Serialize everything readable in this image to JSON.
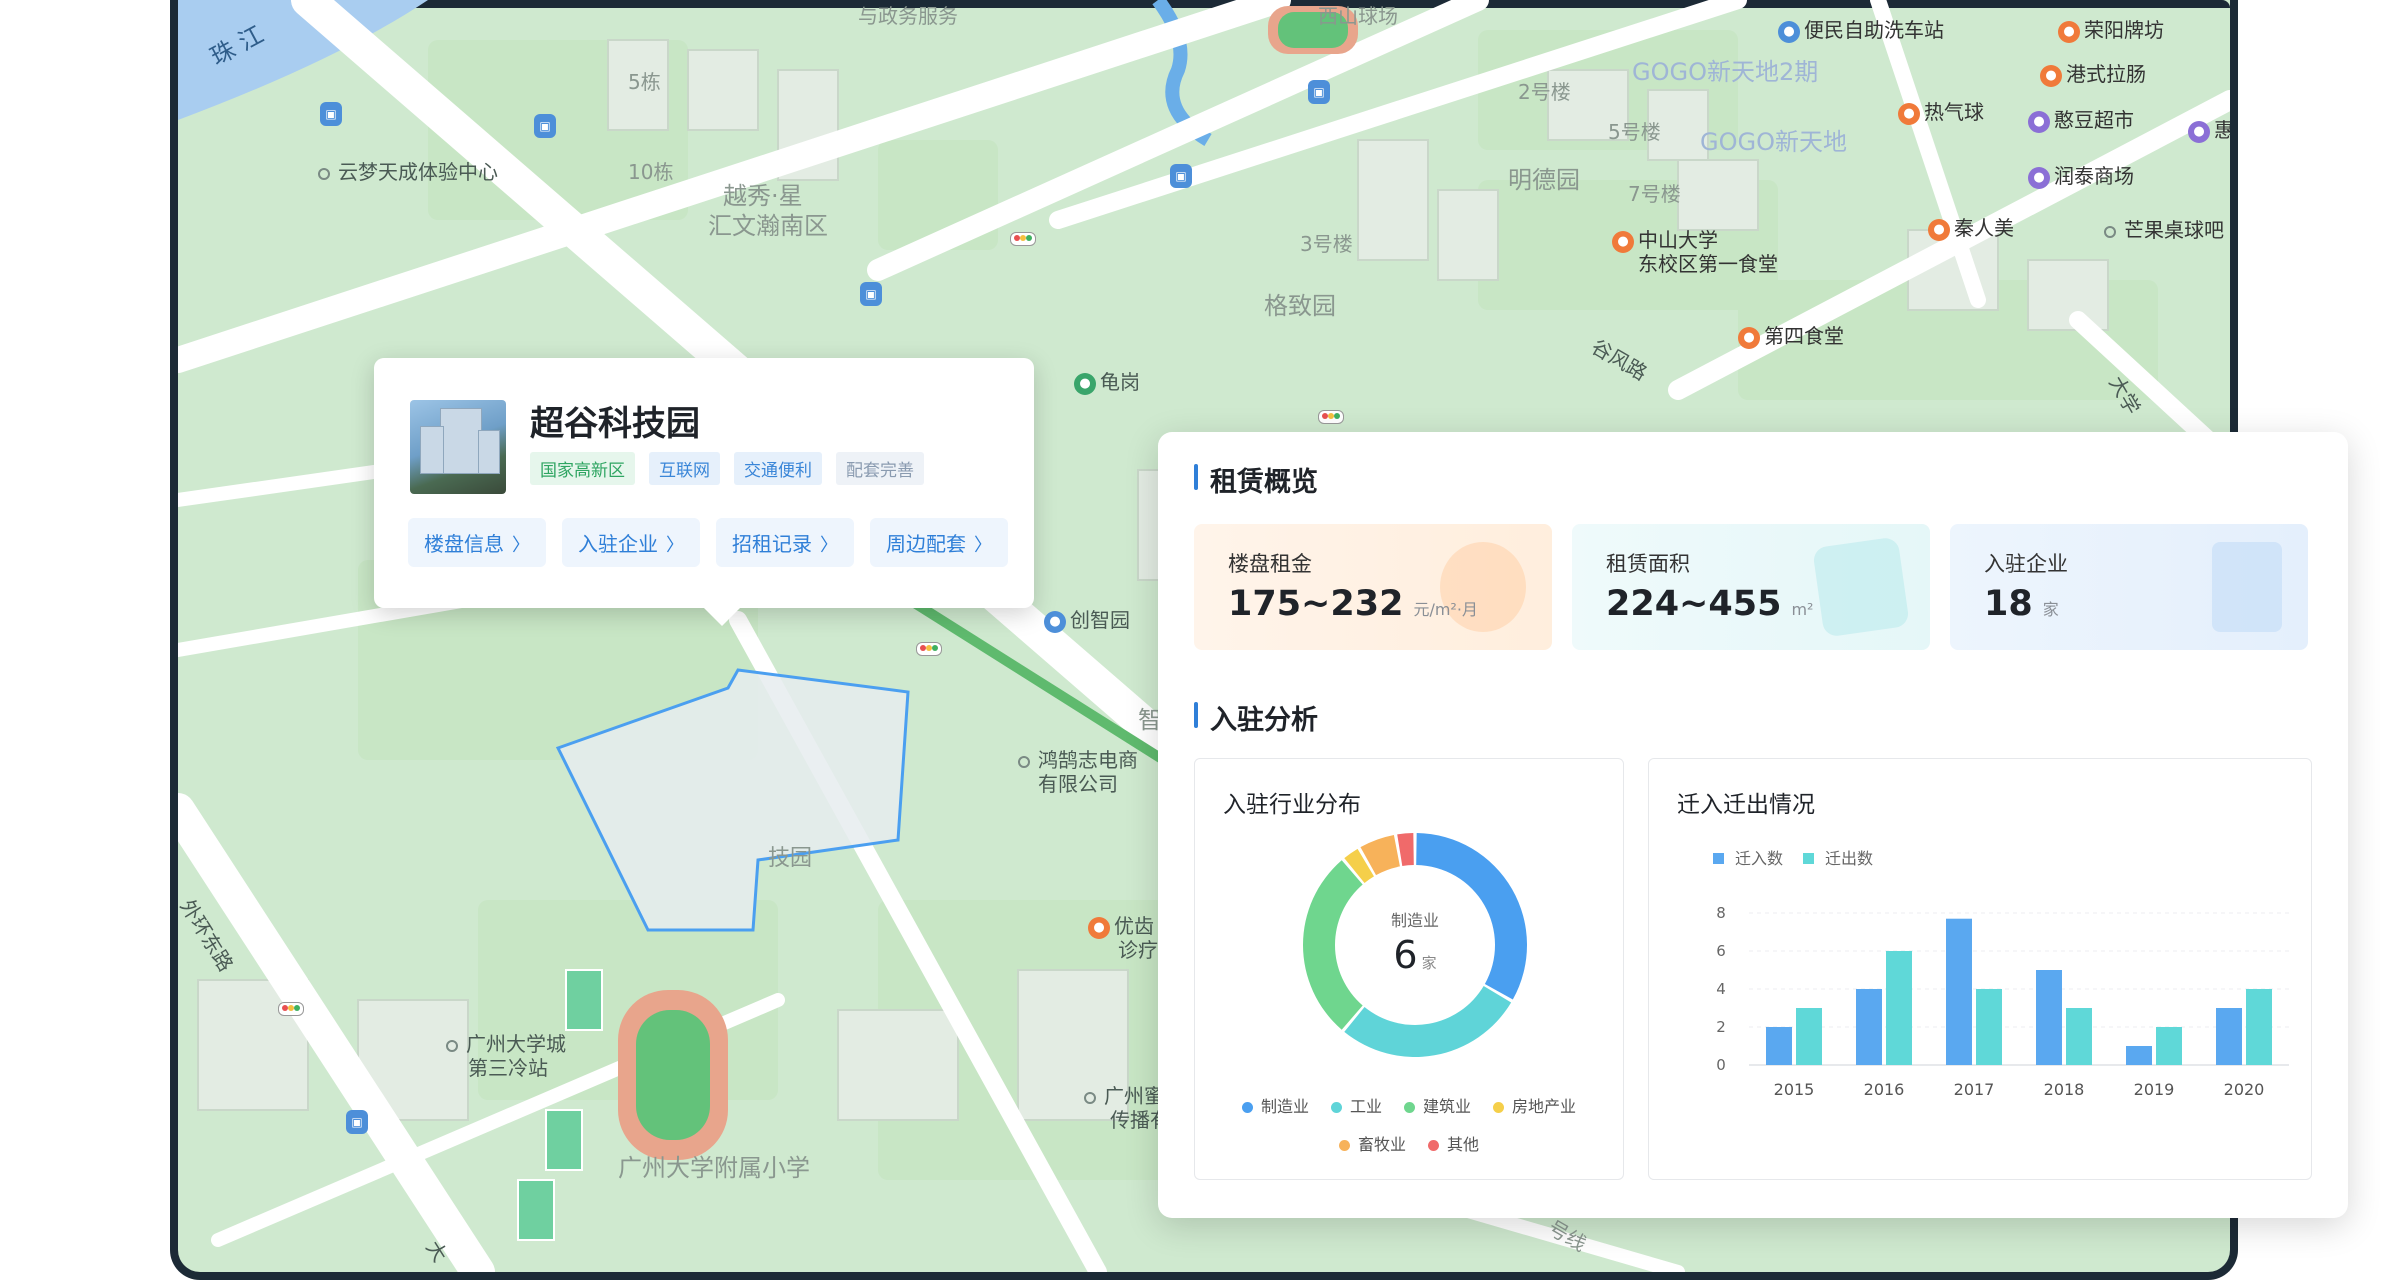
{
  "map": {
    "labels": [
      {
        "text": "珠 江",
        "grey": false
      },
      {
        "text": "5栋",
        "grey": true
      },
      {
        "text": "10栋",
        "grey": true
      },
      {
        "text": "越秀·星",
        "grey": true
      },
      {
        "text": "汇文瀚南区",
        "grey": true
      },
      {
        "text": "云梦天成体验中心",
        "grey": false
      },
      {
        "text": "2号楼",
        "grey": true
      },
      {
        "text": "5号楼",
        "grey": true
      },
      {
        "text": "7号楼",
        "grey": true
      },
      {
        "text": "3号楼",
        "grey": true
      },
      {
        "text": "明德园",
        "grey": true
      },
      {
        "text": "格致园",
        "grey": true
      },
      {
        "text": "GOGO新天地2期",
        "grey": true
      },
      {
        "text": "GOGO新天地",
        "grey": true
      },
      {
        "text": "龟岗",
        "grey": false
      },
      {
        "text": "谷风路",
        "grey": false
      },
      {
        "text": "创智园",
        "grey": false
      },
      {
        "text": "鸿鹄志电商",
        "grey": false
      },
      {
        "text": "有限公司",
        "grey": false
      },
      {
        "text": "技园",
        "grey": true
      },
      {
        "text": "优齿",
        "grey": false
      },
      {
        "text": "诊疗",
        "grey": false
      },
      {
        "text": "广州大学城",
        "grey": false
      },
      {
        "text": "第三冷站",
        "grey": false
      },
      {
        "text": "广州大学附属小学",
        "grey": true
      },
      {
        "text": "广州蜜",
        "grey": false
      },
      {
        "text": "传播有",
        "grey": false
      },
      {
        "text": "大学",
        "grey": false
      },
      {
        "text": "外环东路",
        "grey": false
      },
      {
        "text": "大",
        "grey": false
      },
      {
        "text": "智",
        "grey": true
      },
      {
        "text": "号线",
        "grey": true
      },
      {
        "text": "西山球场",
        "grey": true
      },
      {
        "text": "与政务服务",
        "grey": true
      }
    ],
    "pois": [
      {
        "text": "便民自助洗车站",
        "icon": "car-wash-icon",
        "color": "#4d8fd9"
      },
      {
        "text": "荣阳牌坊",
        "icon": "landmark-icon",
        "color": "#f07a3a"
      },
      {
        "text": "港式拉肠",
        "icon": "restaurant-icon",
        "color": "#f07a3a"
      },
      {
        "text": "热气球",
        "icon": "restaurant-icon",
        "color": "#f07a3a"
      },
      {
        "text": "憨豆超市",
        "icon": "shop-icon",
        "color": "#8b6fd6"
      },
      {
        "text": "惠",
        "icon": "shop-icon",
        "color": "#8b6fd6"
      },
      {
        "text": "润泰商场",
        "icon": "shop-icon",
        "color": "#8b6fd6"
      },
      {
        "text": "秦人美",
        "icon": "restaurant-icon",
        "color": "#f07a3a"
      },
      {
        "text": "芒果桌球吧",
        "icon": "dot-icon",
        "color": "#7a8a84"
      },
      {
        "text": "中山大学",
        "icon": "restaurant-icon",
        "color": "#f07a3a"
      },
      {
        "text": "东校区第一食堂",
        "icon": "none",
        "color": "#f07a3a"
      },
      {
        "text": "第四食堂",
        "icon": "restaurant-icon",
        "color": "#f07a3a"
      }
    ]
  },
  "park_card": {
    "title": "超谷科技园",
    "tags": [
      "国家高新区",
      "互联网",
      "交通便利",
      "配套完善"
    ],
    "buttons": [
      "楼盘信息",
      "入驻企业",
      "招租记录",
      "周边配套"
    ]
  },
  "panel": {
    "rent_title": "租赁概览",
    "stats": [
      {
        "label": "楼盘租金",
        "value": "175~232",
        "unit": "元/m²·月"
      },
      {
        "label": "租赁面积",
        "value": "224~455",
        "unit": "m²"
      },
      {
        "label": "入驻企业",
        "value": "18",
        "unit": "家"
      }
    ],
    "analysis_title": "入驻分析",
    "industry_title": "入驻行业分布",
    "migration_title": "迁入迁出情况"
  },
  "chart_data": [
    {
      "type": "pie",
      "title": "入驻行业分布",
      "center_label": "制造业",
      "center_value": "6",
      "center_unit": "家",
      "slices": [
        {
          "name": "制造业",
          "value": 6,
          "color": "#4a9ff0"
        },
        {
          "name": "工业",
          "value": 5,
          "color": "#5fd4d8"
        },
        {
          "name": "建筑业",
          "value": 5,
          "color": "#6fd68e"
        },
        {
          "name": "房地产业",
          "value": 0.5,
          "color": "#f5cf4a"
        },
        {
          "name": "畜牧业",
          "value": 1,
          "color": "#f7b25a"
        },
        {
          "name": "其他",
          "value": 0.5,
          "color": "#f06a6a"
        }
      ]
    },
    {
      "type": "bar",
      "title": "迁入迁出情况",
      "categories": [
        "2015",
        "2016",
        "2017",
        "2018",
        "2019",
        "2020"
      ],
      "series": [
        {
          "name": "迁入数",
          "values": [
            2,
            4,
            7.7,
            5,
            1,
            3
          ],
          "color": "#5aa8f0"
        },
        {
          "name": "迁出数",
          "values": [
            3,
            6,
            4,
            3,
            2,
            4
          ],
          "color": "#5fd8d8"
        }
      ],
      "yticks": [
        0,
        2,
        4,
        6,
        8
      ],
      "ylim": [
        0,
        8
      ],
      "legend": "top-left",
      "grid": true
    }
  ]
}
